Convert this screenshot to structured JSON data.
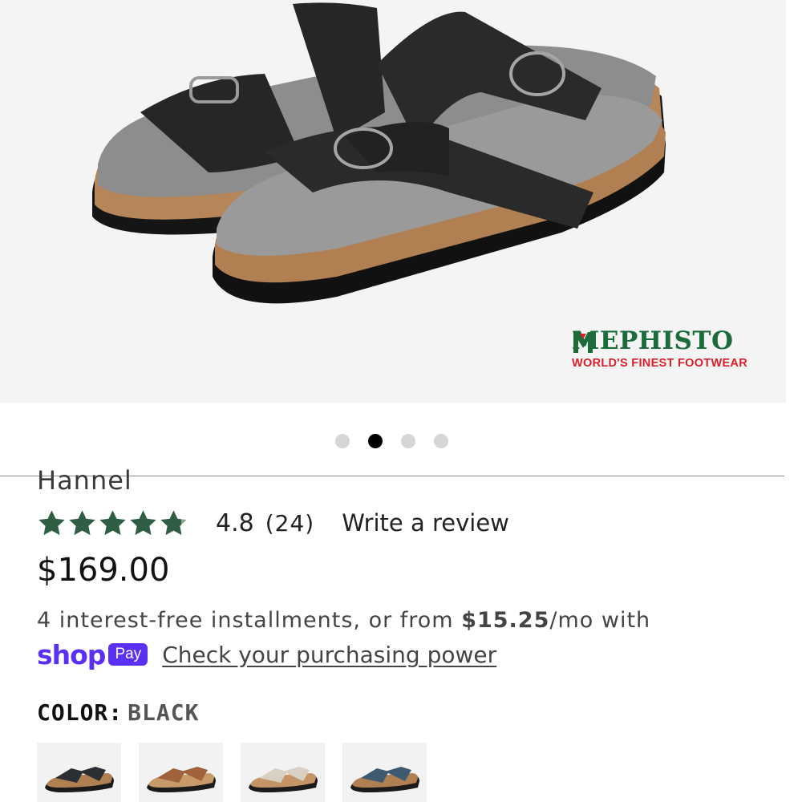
{
  "brand": {
    "name": "MEPHISTO",
    "tagline": "WORLD'S FINEST FOOTWEAR"
  },
  "gallery": {
    "slide_count": 4,
    "active_index": 1
  },
  "product": {
    "title": "Hannel",
    "rating_value": "4.8",
    "rating_stars": 4.8,
    "review_count": "(24)",
    "write_review_label": "Write a review",
    "price": "$169.00"
  },
  "installments": {
    "text_before": "4 interest-free installments, or from ",
    "amount": "$15.25",
    "text_after": "/mo with"
  },
  "shop_pay": {
    "shop_word": "shop",
    "pay_badge": "Pay",
    "link_label": "Check your purchasing power",
    "color": "#5a31f4"
  },
  "color_selector": {
    "label": "COLOR:",
    "selected": "BLACK",
    "options": [
      {
        "name": "black",
        "strap": "#2b2f33"
      },
      {
        "name": "tan",
        "strap": "#a0623a"
      },
      {
        "name": "cream",
        "strap": "#d8d0c2"
      },
      {
        "name": "blue",
        "strap": "#3d5a70"
      }
    ]
  },
  "colors": {
    "brand_green": "#1c6b3a",
    "brand_red": "#d8202a",
    "star_green": "#2e5e43"
  }
}
